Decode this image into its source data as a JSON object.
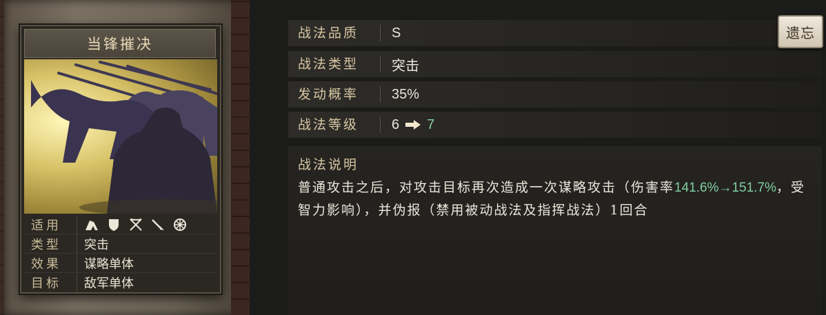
{
  "card": {
    "title": "当锋摧决",
    "attributes": [
      {
        "key": "适用",
        "value": ""
      },
      {
        "key": "类型",
        "value": "突击"
      },
      {
        "key": "效果",
        "value": "谋略单体"
      },
      {
        "key": "目标",
        "value": "敌军单体"
      }
    ],
    "troop_icons": [
      "cavalry-icon",
      "shield-icon",
      "bow-icon",
      "spear-icon",
      "wheel-icon"
    ]
  },
  "info": {
    "quality_label": "战法品质",
    "quality_value": "S",
    "type_label": "战法类型",
    "type_value": "突击",
    "rate_label": "发动概率",
    "rate_value": "35%",
    "level_label": "战法等级",
    "level_from": "6",
    "level_to": "7"
  },
  "remove_button": {
    "label": "遗忘"
  },
  "description": {
    "title": "战法说明",
    "part1": "普通攻击之后，对攻击目标再次造成一次谋略攻击（伤害率",
    "green": "141.6%→151.7%",
    "part2": "，受智力影响），并伪报（禁用被动战法及指挥战法）1回合"
  },
  "colors": {
    "highlight_green": "#7fcfa0",
    "label_gold": "#d6c6a3"
  }
}
